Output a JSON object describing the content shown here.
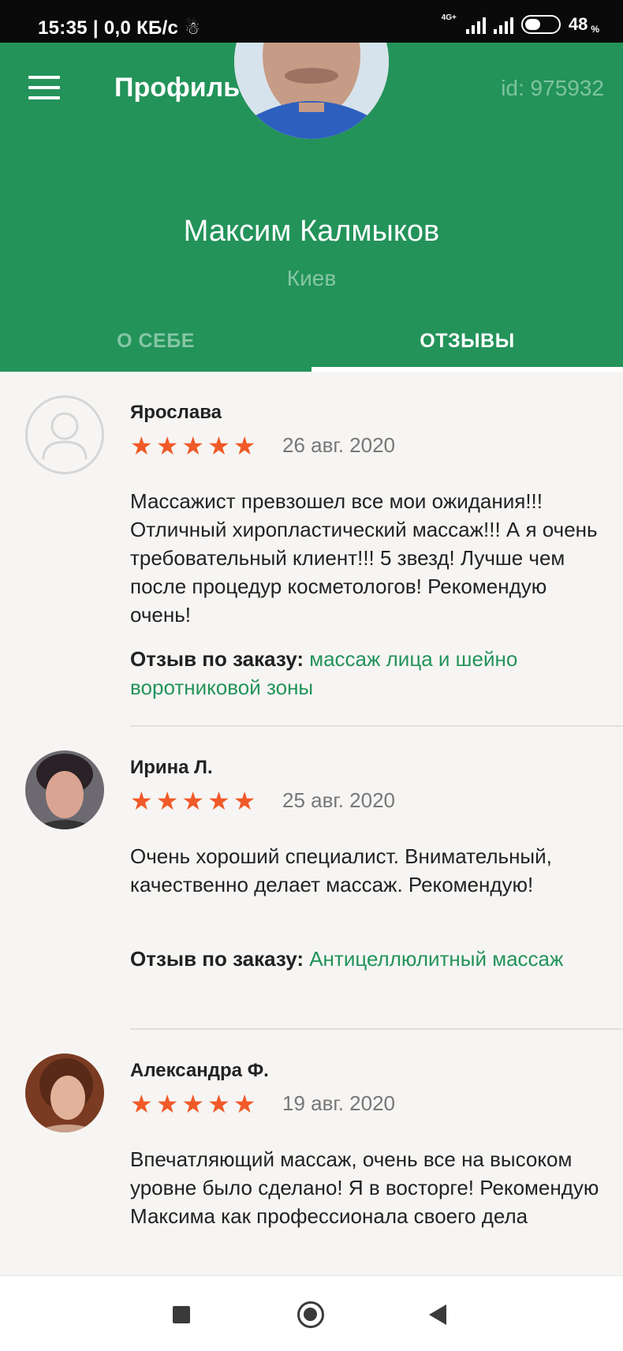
{
  "status_bar": {
    "time_speed": "15:35 | 0,0 КБ/с",
    "network": "4G+",
    "battery": "48",
    "battery_unit": "%"
  },
  "header": {
    "title": "Профиль",
    "id_text": "id: 975932",
    "menu_icon": "hamburger-menu-icon"
  },
  "profile": {
    "name": "Максим Калмыков",
    "city": "Киев"
  },
  "tabs": [
    {
      "label": "О СЕБЕ",
      "active": false
    },
    {
      "label": "ОТЗЫВЫ",
      "active": true
    }
  ],
  "reviews": [
    {
      "author": "Ярослава",
      "stars": "★★★★★",
      "rating": 5,
      "date": "26 авг. 2020",
      "text": "Массажист превзошел все мои ожидания!!! Отличный хиропластический массаж!!! А я очень требовательный клиент!!! 5 звезд! Лучше чем после процедур косметологов! Рекомендую очень!",
      "order_label": "Отзыв по заказу:",
      "order_link": "массаж лица и шейно воротниковой зоны"
    },
    {
      "author": "Ирина Л.",
      "stars": "★★★★★",
      "rating": 5,
      "date": "25 авг. 2020",
      "text": "Очень хороший специалист. Внимательный, качественно делает массаж. Рекомендую!",
      "order_label": "Отзыв по заказу:",
      "order_link": "Антицеллюлитный массаж"
    },
    {
      "author": "Александра Ф.",
      "stars": "★★★★★",
      "rating": 5,
      "date": "19 авг. 2020",
      "text": "Впечатляющий массаж, очень все на высоком уровне было сделано! Я в восторге! Рекомендую Максима как профессионала своего дела"
    }
  ],
  "colors": {
    "accent": "#23935a",
    "star": "#f05a28",
    "background": "#f7f5f3"
  }
}
